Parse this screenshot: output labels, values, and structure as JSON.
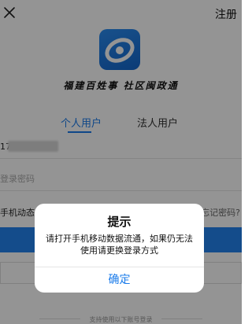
{
  "header": {
    "register_label": "注册"
  },
  "branding": {
    "slogan": "福建百姓事 社区闽政通"
  },
  "tabs": [
    {
      "label": "个人用户",
      "active": true
    },
    {
      "label": "法人用户",
      "active": false
    }
  ],
  "form": {
    "phone_prefix": "17",
    "password_placeholder": "登录密码",
    "sms_login_label": "手机动态",
    "forgot_password_label": "忘记密码?"
  },
  "footer": {
    "other_login_hint": "支持使用以下账号登录"
  },
  "dialog": {
    "title": "提示",
    "message": "请打开手机移动数据流通，如果仍无法使用请更换登录方式",
    "confirm_label": "确定"
  },
  "colors": {
    "accent": "#1a7bea",
    "primary_button": "#2484f0"
  }
}
